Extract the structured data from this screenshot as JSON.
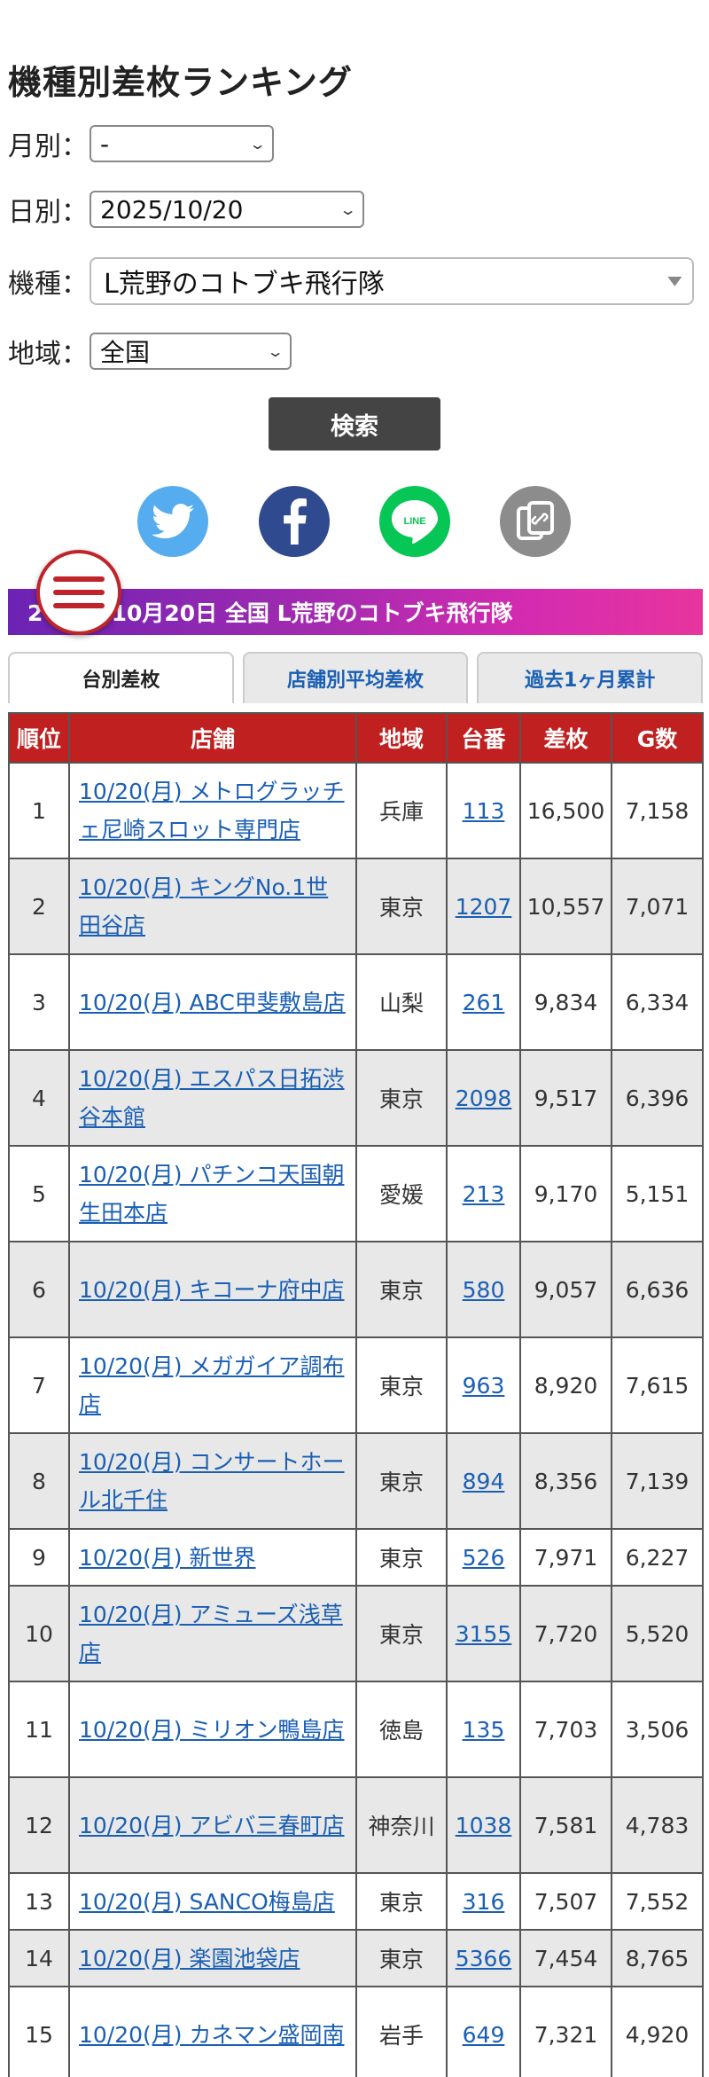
{
  "page": {
    "title": "機種別差枚ランキング"
  },
  "filters": {
    "month": {
      "label": "月別：",
      "value": "-"
    },
    "day": {
      "label": "日別：",
      "value": "2025/10/20"
    },
    "machine": {
      "label": "機種：",
      "value": "L荒野のコトブキ飛行隊"
    },
    "region": {
      "label": "地域：",
      "value": "全国"
    }
  },
  "search_button": "検索",
  "share": {
    "twitter_icon": "twitter-bird-icon",
    "facebook_icon": "facebook-f-icon",
    "line_label": "LINE",
    "copy_icon": "copy-link-icon",
    "colors": {
      "twitter": "#55acee",
      "facebook": "#2f4a8e",
      "line": "#06c755",
      "copy": "#8c8c8c"
    }
  },
  "banner": {
    "title": "2025年10月20日 全国 L荒野のコトブキ飛行隊"
  },
  "tabs": [
    "台別差枚",
    "店舗別平均差枚",
    "過去1ヶ月累計"
  ],
  "table": {
    "headers": [
      "順位",
      "店舗",
      "地域",
      "台番",
      "差枚",
      "G数"
    ],
    "rows": [
      {
        "rank": "1",
        "shop": "10/20(月) メトログラッチェ尼崎スロット専門店",
        "region": "兵庫",
        "unit": "113",
        "diff": "16,500",
        "games": "7,158"
      },
      {
        "rank": "2",
        "shop": "10/20(月) キングNo.1世田谷店",
        "region": "東京",
        "unit": "1207",
        "diff": "10,557",
        "games": "7,071"
      },
      {
        "rank": "3",
        "shop": "10/20(月) ABC甲斐敷島店",
        "region": "山梨",
        "unit": "261",
        "diff": "9,834",
        "games": "6,334"
      },
      {
        "rank": "4",
        "shop": "10/20(月) エスパス日拓渋谷本館",
        "region": "東京",
        "unit": "2098",
        "diff": "9,517",
        "games": "6,396"
      },
      {
        "rank": "5",
        "shop": "10/20(月) パチンコ天国朝生田本店",
        "region": "愛媛",
        "unit": "213",
        "diff": "9,170",
        "games": "5,151"
      },
      {
        "rank": "6",
        "shop": "10/20(月) キコーナ府中店",
        "region": "東京",
        "unit": "580",
        "diff": "9,057",
        "games": "6,636"
      },
      {
        "rank": "7",
        "shop": "10/20(月) メガガイア調布店",
        "region": "東京",
        "unit": "963",
        "diff": "8,920",
        "games": "7,615"
      },
      {
        "rank": "8",
        "shop": "10/20(月) コンサートホール北千住",
        "region": "東京",
        "unit": "894",
        "diff": "8,356",
        "games": "7,139"
      },
      {
        "rank": "9",
        "shop": "10/20(月) 新世界",
        "region": "東京",
        "unit": "526",
        "diff": "7,971",
        "games": "6,227"
      },
      {
        "rank": "10",
        "shop": "10/20(月) アミューズ浅草店",
        "region": "東京",
        "unit": "3155",
        "diff": "7,720",
        "games": "5,520"
      },
      {
        "rank": "11",
        "shop": "10/20(月) ミリオン鴨島店",
        "region": "徳島",
        "unit": "135",
        "diff": "7,703",
        "games": "3,506"
      },
      {
        "rank": "12",
        "shop": "10/20(月) アビバ三春町店",
        "region": "神奈川",
        "unit": "1038",
        "diff": "7,581",
        "games": "4,783"
      },
      {
        "rank": "13",
        "shop": "10/20(月) SANCO梅島店",
        "region": "東京",
        "unit": "316",
        "diff": "7,507",
        "games": "7,552"
      },
      {
        "rank": "14",
        "shop": "10/20(月) 楽園池袋店",
        "region": "東京",
        "unit": "5366",
        "diff": "7,454",
        "games": "8,765"
      },
      {
        "rank": "15",
        "shop": "10/20(月) カネマン盛岡南",
        "region": "岩手",
        "unit": "649",
        "diff": "7,321",
        "games": "4,920"
      }
    ]
  }
}
